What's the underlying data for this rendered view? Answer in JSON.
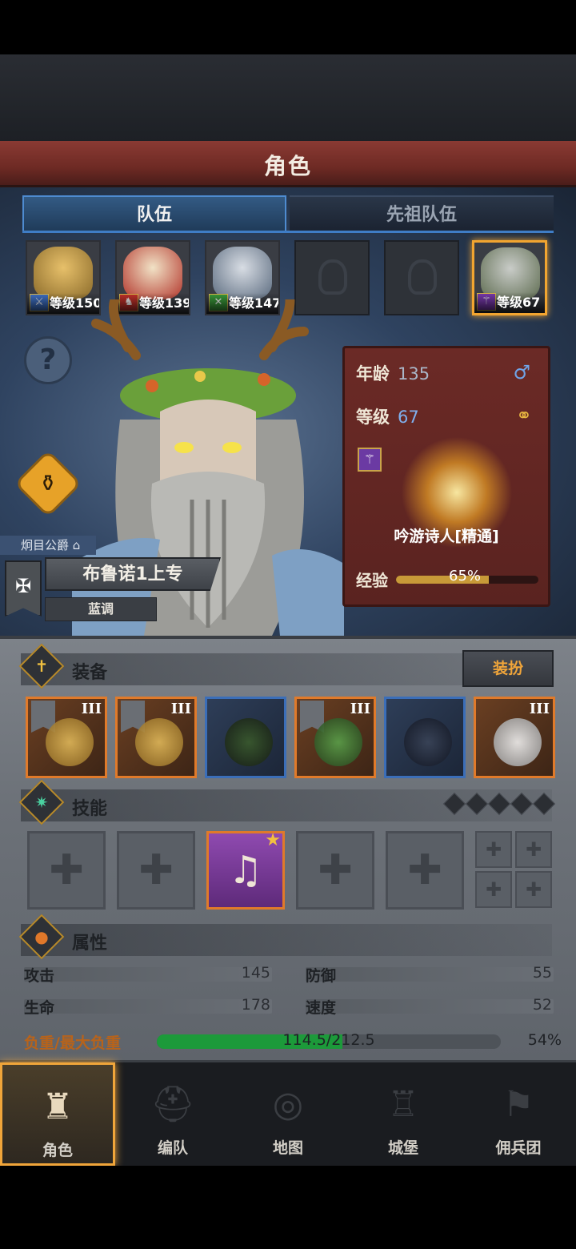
{
  "header": {
    "title": "角色"
  },
  "tabs": [
    {
      "label": "队伍",
      "active": true
    },
    {
      "label": "先祖队伍",
      "active": false
    }
  ],
  "party": [
    {
      "level_text": "等级150",
      "class_icon": "sword-icon",
      "empty": false
    },
    {
      "level_text": "等级139",
      "class_icon": "horse-icon",
      "empty": false
    },
    {
      "level_text": "等级147",
      "class_icon": "crossed-swords-icon",
      "empty": false
    },
    {
      "empty": true
    },
    {
      "empty": true
    },
    {
      "level_text": "等级67",
      "class_icon": "staff-icon",
      "empty": false,
      "selected": true
    }
  ],
  "character": {
    "rank_title": "炯目公爵",
    "name": "布鲁诺1上专",
    "tune": "蓝调",
    "age_label": "年龄",
    "age": "135",
    "level_label": "等级",
    "level": "67",
    "class_name": "吟游诗人[精通]",
    "exp_label": "经验",
    "exp_percent": "65%",
    "exp_fraction": 0.65,
    "gender_icon": "male-icon",
    "ring_icon": "rings-icon"
  },
  "equipment": {
    "label": "装备",
    "dress_button": "装扮",
    "items": [
      {
        "name": "golden-harp-weapon",
        "tier": "III",
        "rarity": "orange",
        "banner": true
      },
      {
        "name": "golden-harp-weapon",
        "tier": "III",
        "rarity": "orange",
        "banner": true
      },
      {
        "name": "green-hood",
        "tier": "",
        "rarity": "blue",
        "banner": false
      },
      {
        "name": "green-armor",
        "tier": "III",
        "rarity": "orange",
        "banner": true
      },
      {
        "name": "dark-boots",
        "tier": "",
        "rarity": "blue",
        "banner": false
      },
      {
        "name": "silver-ring-accessory",
        "tier": "III",
        "rarity": "orange",
        "banner": false
      }
    ]
  },
  "skills": {
    "label": "技能",
    "gem_slots": 5
  },
  "attributes": {
    "label": "属性",
    "attack_label": "攻击",
    "attack": "145",
    "defense_label": "防御",
    "defense": "55",
    "hp_label": "生命",
    "hp": "178",
    "speed_label": "速度",
    "speed": "52",
    "load_label": "负重/最大负重",
    "load_value": "114.5/212.5",
    "load_percent": "54%",
    "load_fraction": 0.54
  },
  "nav": [
    {
      "label": "角色",
      "icon": "knight-icon",
      "active": true
    },
    {
      "label": "编队",
      "icon": "helmet-icon",
      "active": false
    },
    {
      "label": "地图",
      "icon": "compass-icon",
      "active": false
    },
    {
      "label": "城堡",
      "icon": "castle-icon",
      "active": false
    },
    {
      "label": "佣兵团",
      "icon": "mercenary-icon",
      "active": false
    }
  ],
  "colors": {
    "accent": "#f0a53a",
    "header_red": "#7a302a",
    "tab_blue": "#3f7dc6",
    "load_green": "#1c9a3a"
  }
}
